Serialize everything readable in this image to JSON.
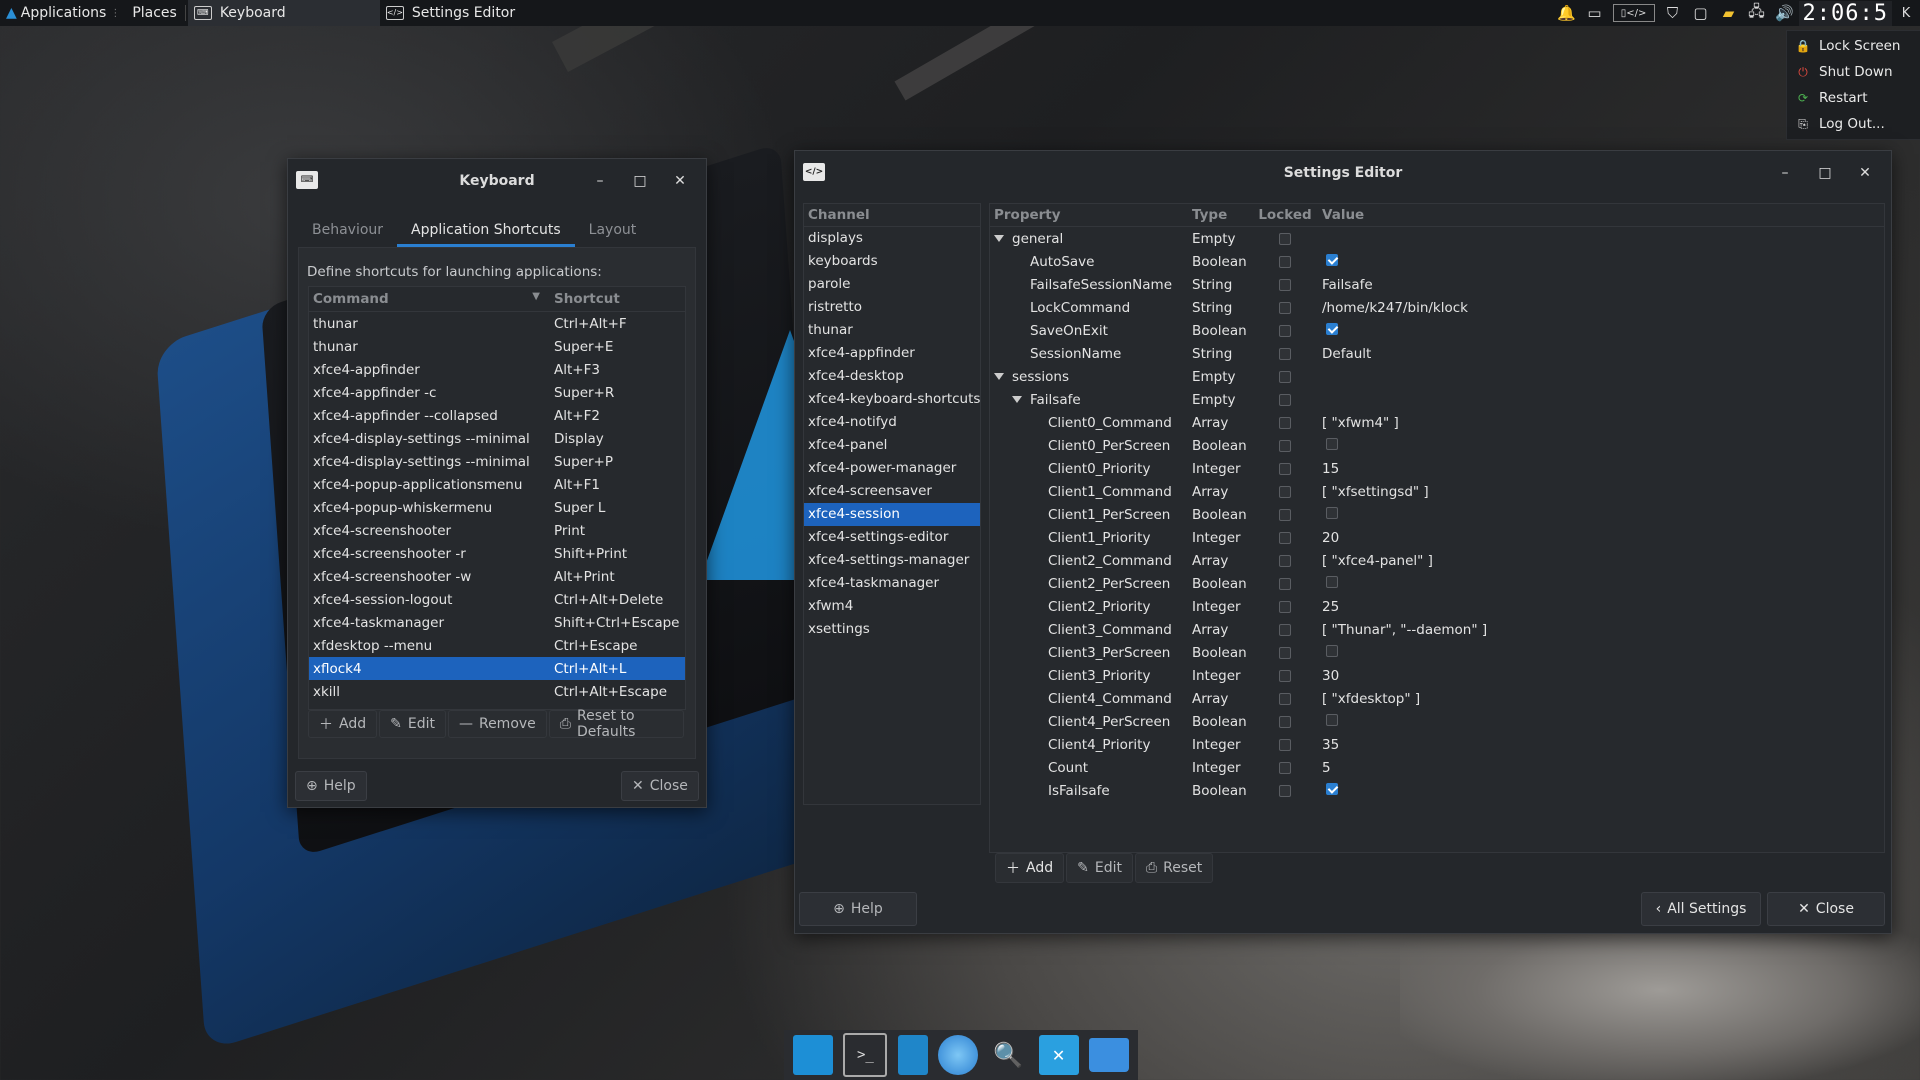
{
  "panel": {
    "applications": "Applications",
    "places": "Places",
    "tasks": [
      {
        "label": "Keyboard",
        "active": true
      },
      {
        "label": "Settings Editor",
        "active": false
      }
    ],
    "clock": "2:06:5",
    "user_initial": "K"
  },
  "power_menu": {
    "items": [
      {
        "label": "Lock Screen",
        "icon": "lock-icon",
        "color": "#dddddd"
      },
      {
        "label": "Shut Down",
        "icon": "power-icon",
        "color": "#e04a3f"
      },
      {
        "label": "Restart",
        "icon": "restart-icon",
        "color": "#4caf50"
      },
      {
        "label": "Log Out...",
        "icon": "logout-icon",
        "color": "#dddddd"
      }
    ]
  },
  "keyboard_window": {
    "title": "Keyboard",
    "tabs": [
      "Behaviour",
      "Application Shortcuts",
      "Layout"
    ],
    "active_tab": "Application Shortcuts",
    "description": "Define shortcuts for launching applications:",
    "columns": {
      "command": "Command",
      "shortcut": "Shortcut"
    },
    "rows": [
      {
        "command": "thunar",
        "shortcut": "Ctrl+Alt+F"
      },
      {
        "command": "thunar",
        "shortcut": "Super+E"
      },
      {
        "command": "xfce4-appfinder",
        "shortcut": "Alt+F3"
      },
      {
        "command": "xfce4-appfinder -c",
        "shortcut": "Super+R"
      },
      {
        "command": "xfce4-appfinder --collapsed",
        "shortcut": "Alt+F2"
      },
      {
        "command": "xfce4-display-settings --minimal",
        "shortcut": "Display"
      },
      {
        "command": "xfce4-display-settings --minimal",
        "shortcut": "Super+P"
      },
      {
        "command": "xfce4-popup-applicationsmenu",
        "shortcut": "Alt+F1"
      },
      {
        "command": "xfce4-popup-whiskermenu",
        "shortcut": "Super L"
      },
      {
        "command": "xfce4-screenshooter",
        "shortcut": "Print"
      },
      {
        "command": "xfce4-screenshooter -r",
        "shortcut": "Shift+Print"
      },
      {
        "command": "xfce4-screenshooter -w",
        "shortcut": "Alt+Print"
      },
      {
        "command": "xfce4-session-logout",
        "shortcut": "Ctrl+Alt+Delete"
      },
      {
        "command": "xfce4-taskmanager",
        "shortcut": "Shift+Ctrl+Escape"
      },
      {
        "command": "xfdesktop --menu",
        "shortcut": "Ctrl+Escape"
      },
      {
        "command": "xflock4",
        "shortcut": "Ctrl+Alt+L",
        "selected": true
      },
      {
        "command": "xkill",
        "shortcut": "Ctrl+Alt+Escape"
      }
    ],
    "actions": {
      "add": "Add",
      "edit": "Edit",
      "remove": "Remove",
      "reset": "Reset to Defaults"
    },
    "help": "Help",
    "close": "Close"
  },
  "settings_editor": {
    "title": "Settings Editor",
    "channel_header": "Channel",
    "channels": [
      "displays",
      "keyboards",
      "parole",
      "ristretto",
      "thunar",
      "xfce4-appfinder",
      "xfce4-desktop",
      "xfce4-keyboard-shortcuts",
      "xfce4-notifyd",
      "xfce4-panel",
      "xfce4-power-manager",
      "xfce4-screensaver",
      "xfce4-session",
      "xfce4-settings-editor",
      "xfce4-settings-manager",
      "xfce4-taskmanager",
      "xfwm4",
      "xsettings"
    ],
    "selected_channel": "xfce4-session",
    "columns": {
      "property": "Property",
      "type": "Type",
      "locked": "Locked",
      "value": "Value"
    },
    "properties": [
      {
        "name": "general",
        "type": "Empty",
        "value": "",
        "level": 0,
        "expander": true
      },
      {
        "name": "AutoSave",
        "type": "Boolean",
        "value": "",
        "level": 1,
        "checkbox": true,
        "checked": true
      },
      {
        "name": "FailsafeSessionName",
        "type": "String",
        "value": "Failsafe",
        "level": 1
      },
      {
        "name": "LockCommand",
        "type": "String",
        "value": "/home/k247/bin/klock",
        "level": 1
      },
      {
        "name": "SaveOnExit",
        "type": "Boolean",
        "value": "",
        "level": 1,
        "checkbox": true,
        "checked": true
      },
      {
        "name": "SessionName",
        "type": "String",
        "value": "Default",
        "level": 1
      },
      {
        "name": "sessions",
        "type": "Empty",
        "value": "",
        "level": 0,
        "expander": true
      },
      {
        "name": "Failsafe",
        "type": "Empty",
        "value": "",
        "level": 1,
        "expander": true
      },
      {
        "name": "Client0_Command",
        "type": "Array",
        "value": "[ \"xfwm4\" ]",
        "level": 2
      },
      {
        "name": "Client0_PerScreen",
        "type": "Boolean",
        "value": "",
        "level": 2,
        "checkbox": true,
        "checked": false
      },
      {
        "name": "Client0_Priority",
        "type": "Integer",
        "value": "15",
        "level": 2
      },
      {
        "name": "Client1_Command",
        "type": "Array",
        "value": "[ \"xfsettingsd\" ]",
        "level": 2
      },
      {
        "name": "Client1_PerScreen",
        "type": "Boolean",
        "value": "",
        "level": 2,
        "checkbox": true,
        "checked": false
      },
      {
        "name": "Client1_Priority",
        "type": "Integer",
        "value": "20",
        "level": 2
      },
      {
        "name": "Client2_Command",
        "type": "Array",
        "value": "[ \"xfce4-panel\" ]",
        "level": 2
      },
      {
        "name": "Client2_PerScreen",
        "type": "Boolean",
        "value": "",
        "level": 2,
        "checkbox": true,
        "checked": false
      },
      {
        "name": "Client2_Priority",
        "type": "Integer",
        "value": "25",
        "level": 2
      },
      {
        "name": "Client3_Command",
        "type": "Array",
        "value": "[ \"Thunar\", \"--daemon\" ]",
        "level": 2
      },
      {
        "name": "Client3_PerScreen",
        "type": "Boolean",
        "value": "",
        "level": 2,
        "checkbox": true,
        "checked": false
      },
      {
        "name": "Client3_Priority",
        "type": "Integer",
        "value": "30",
        "level": 2
      },
      {
        "name": "Client4_Command",
        "type": "Array",
        "value": "[ \"xfdesktop\" ]",
        "level": 2
      },
      {
        "name": "Client4_PerScreen",
        "type": "Boolean",
        "value": "",
        "level": 2,
        "checkbox": true,
        "checked": false
      },
      {
        "name": "Client4_Priority",
        "type": "Integer",
        "value": "35",
        "level": 2
      },
      {
        "name": "Count",
        "type": "Integer",
        "value": "5",
        "level": 2
      },
      {
        "name": "IsFailsafe",
        "type": "Boolean",
        "value": "",
        "level": 2,
        "checkbox": true,
        "checked": true
      }
    ],
    "actions": {
      "add": "Add",
      "edit": "Edit",
      "reset": "Reset"
    },
    "help": "Help",
    "all_settings": "All Settings",
    "close": "Close"
  },
  "dock": {
    "items": [
      "desktop-icon",
      "terminal-icon",
      "text-editor-icon",
      "web-browser-icon",
      "search-icon",
      "screenshot-icon",
      "folder-icon"
    ]
  },
  "colors": {
    "accent": "#1d63bd",
    "panel": "#15171a",
    "window_bg": "#24272b"
  }
}
